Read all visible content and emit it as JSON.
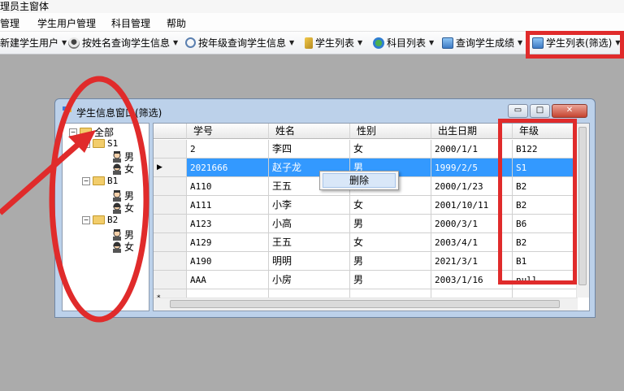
{
  "app": {
    "title": "理员主窗体",
    "menu": [
      "管理",
      "学生用户管理",
      "科目管理",
      "帮助"
    ],
    "toolbar": [
      {
        "label": "新建学生用户",
        "icon": "add-user-icon"
      },
      {
        "label": "按姓名查询学生信息",
        "icon": "person-search-icon"
      },
      {
        "label": "按年级查询学生信息",
        "icon": "magnifier-icon"
      },
      {
        "label": "学生列表",
        "icon": "list-icon"
      },
      {
        "label": "科目列表",
        "icon": "subjects-icon"
      },
      {
        "label": "查询学生成绩",
        "icon": "picture-icon"
      },
      {
        "label": "学生列表(筛选)",
        "icon": "picture-icon"
      }
    ]
  },
  "window": {
    "title": "学生信息窗口(筛选)",
    "controls": {
      "minimize": "▭",
      "maximize": "□",
      "close": "✕"
    }
  },
  "tree": {
    "root": "全部",
    "groups": [
      {
        "name": "S1",
        "children": [
          "男",
          "女"
        ]
      },
      {
        "name": "B1",
        "children": [
          "男",
          "女"
        ]
      },
      {
        "name": "B2",
        "children": [
          "男",
          "女"
        ]
      }
    ]
  },
  "grid": {
    "columns": [
      "学号",
      "姓名",
      "性别",
      "出生日期",
      "年级"
    ],
    "rows": [
      [
        "2",
        "李四",
        "女",
        "2000/1/1",
        "B122"
      ],
      [
        "2021666",
        "赵子龙",
        "男",
        "1999/2/5",
        "S1"
      ],
      [
        "A110",
        "王五",
        "女",
        "2000/1/23",
        "B2"
      ],
      [
        "A111",
        "小李",
        "女",
        "2001/10/11",
        "B2"
      ],
      [
        "A123",
        "小高",
        "男",
        "2000/3/1",
        "B6"
      ],
      [
        "A129",
        "王五",
        "女",
        "2003/4/1",
        "B2"
      ],
      [
        "A190",
        "明明",
        "男",
        "2021/3/1",
        "B1"
      ],
      [
        "AAA",
        "小房",
        "男",
        "2003/1/16",
        "null"
      ]
    ],
    "selected_row": 1,
    "row_marker": "▶",
    "new_row_marker": "*"
  },
  "context_menu": {
    "items": [
      "删除"
    ]
  },
  "colors": {
    "highlight": "#e02b2b",
    "selection": "#3399ff"
  }
}
